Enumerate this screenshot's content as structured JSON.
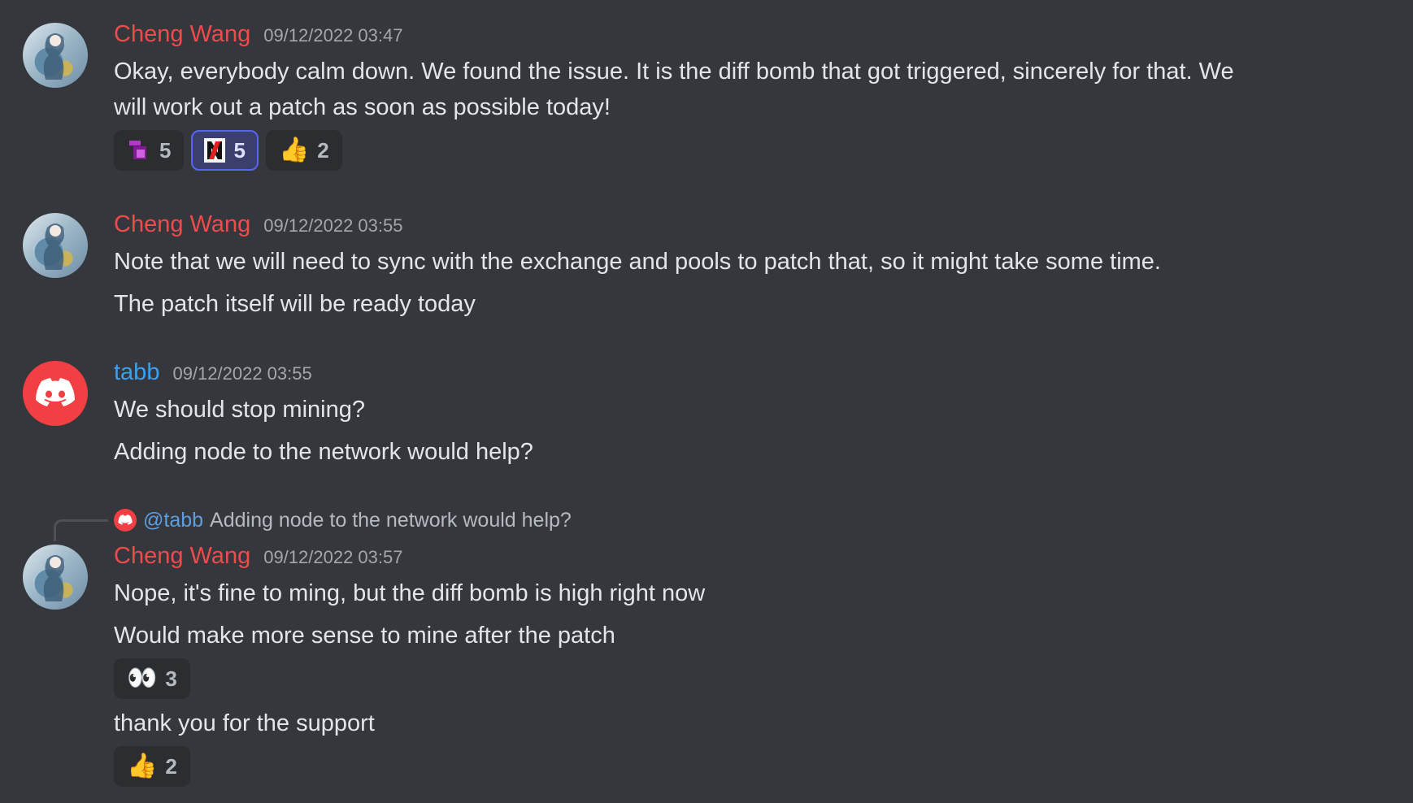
{
  "messages": [
    {
      "author": "Cheng Wang",
      "timestamp": "09/12/2022 03:47",
      "lines": [
        "Okay, everybody calm down. We found the issue. It is the diff bomb that got triggered, sincerely for that. We",
        "will work out a patch as soon as possible today!"
      ],
      "reactions": [
        {
          "emoji_name": "custom-purple-emoji",
          "count": "5"
        },
        {
          "emoji_name": "custom-n-emoji",
          "count": "5"
        },
        {
          "emoji": "👍",
          "count": "2"
        }
      ]
    },
    {
      "author": "Cheng Wang",
      "timestamp": "09/12/2022 03:55",
      "lines": [
        "Note that we will need to sync with the exchange and pools to patch that, so it might take some time.",
        "The patch itself will be ready today"
      ]
    },
    {
      "author": "tabb",
      "timestamp": "09/12/2022 03:55",
      "lines": [
        "We should stop mining?",
        "Adding node to the network would help?"
      ]
    },
    {
      "reply": {
        "mention": "@tabb",
        "text": "Adding node to the network would help?"
      },
      "author": "Cheng Wang",
      "timestamp": "09/12/2022 03:57",
      "lines": [
        "Nope, it's fine to ming, but the diff bomb is high right now",
        "Would make more sense to mine after the patch"
      ],
      "reactions": [
        {
          "emoji": "👀",
          "count": "3"
        }
      ],
      "followup": "thank you for the support",
      "followup_reactions": [
        {
          "emoji": "👍",
          "count": "2"
        }
      ]
    }
  ],
  "colors": {
    "background": "#36373d",
    "author_cheng": "#f04a4a",
    "author_tabb": "#3aa0f0",
    "mention": "#5c9fe0",
    "reaction_active_border": "#5865f2"
  }
}
